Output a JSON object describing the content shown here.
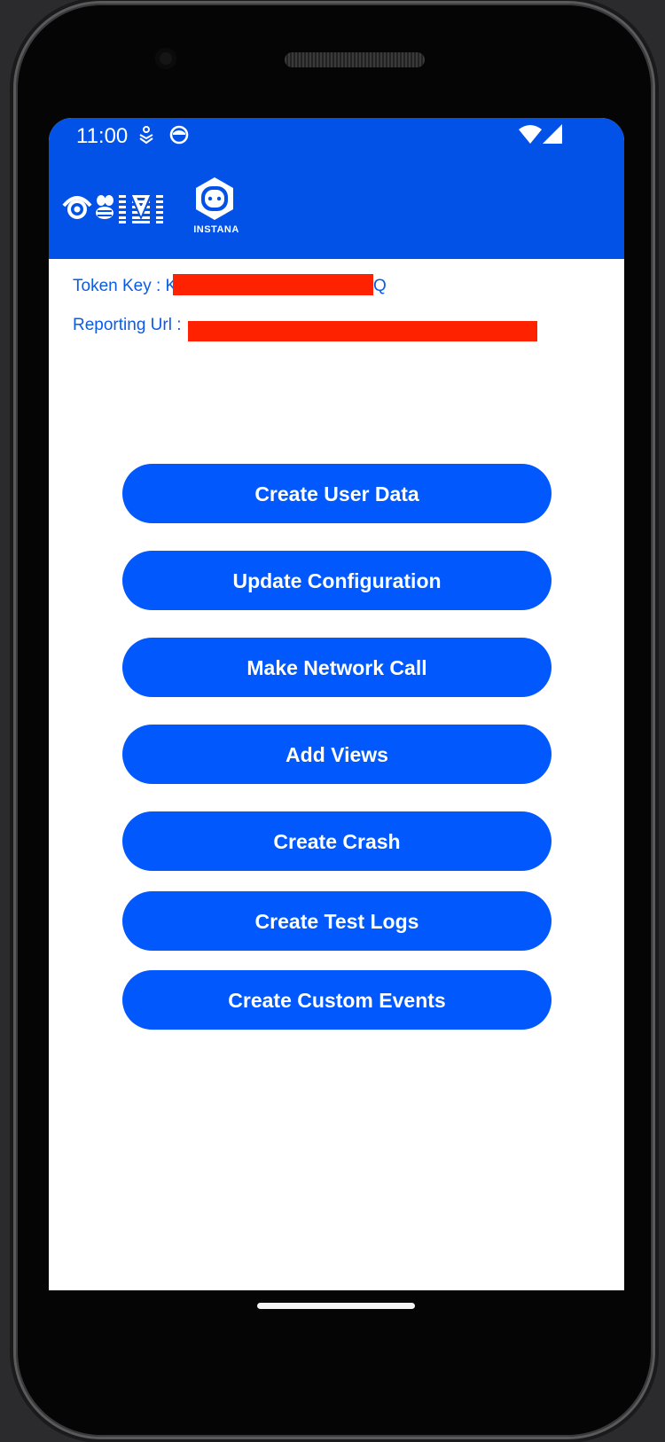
{
  "status_bar": {
    "time": "11:00",
    "icons": [
      "notification-icon",
      "face-icon",
      "wifi-icon",
      "cell-signal-icon"
    ]
  },
  "app_bar": {
    "logos": [
      "ibm-logo",
      "instana-logo"
    ],
    "instana_label": "INSTANA",
    "background_color": "#0352e8"
  },
  "info": {
    "token_key_label": "Token Key : K",
    "token_key_suffix": "Q",
    "reporting_url_label": "Reporting Url :",
    "redaction_color": "#ff2200"
  },
  "buttons": [
    {
      "label": "Create User Data"
    },
    {
      "label": "Update Configuration"
    },
    {
      "label": "Make Network Call"
    },
    {
      "label": "Add Views"
    },
    {
      "label": "Create Crash"
    },
    {
      "label": "Create Test Logs"
    },
    {
      "label": "Create Custom Events"
    }
  ],
  "colors": {
    "primary": "#0158fd",
    "link_text": "#0a5ce8"
  }
}
